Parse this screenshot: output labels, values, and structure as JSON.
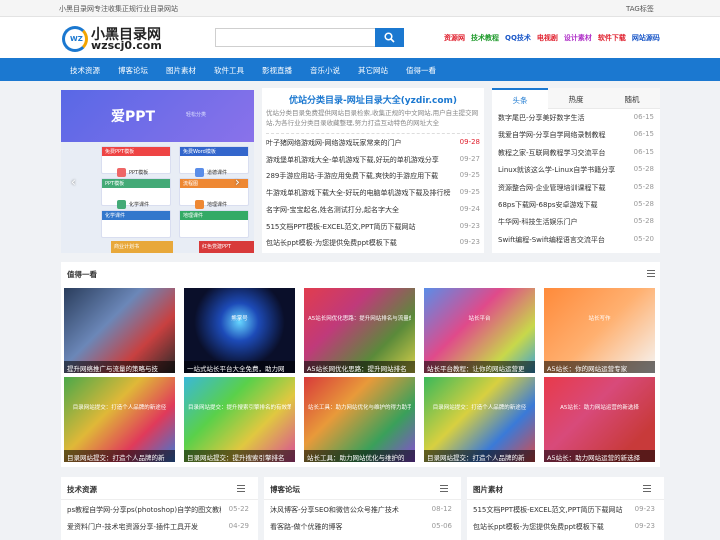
{
  "topbar": {
    "tagline": "小黑目录网专注收集正规行业目录网站",
    "tag_link": "TAG标签"
  },
  "logo": {
    "badge": "WZ",
    "cn": "小黑目录网",
    "en": "wzscj0.com"
  },
  "search": {
    "placeholder": ""
  },
  "hotlinks": [
    {
      "label": "资源网",
      "color": "#e0202e"
    },
    {
      "label": "技术教程",
      "color": "#1e9a2b"
    },
    {
      "label": "QQ技术",
      "color": "#1b58c8"
    },
    {
      "label": "电视剧",
      "color": "#e0202e"
    },
    {
      "label": "设计素材",
      "color": "#b030c8"
    },
    {
      "label": "软件下载",
      "color": "#e0202e"
    },
    {
      "label": "网站源码",
      "color": "#1b58c8"
    }
  ],
  "nav": [
    "技术资源",
    "博客论坛",
    "图片素材",
    "软件工具",
    "影视直播",
    "音乐小说",
    "其它网站",
    "值得一看"
  ],
  "slider": {
    "logo": "爱PPT",
    "sub": "轻松分类",
    "cards": [
      {
        "title": "免费PPT模板",
        "color": "#e44"
      },
      {
        "title": "免费Word模板",
        "color": "#36c"
      },
      {
        "title": "PPT模板",
        "color": "#4a7"
      },
      {
        "title": "流程图",
        "color": "#e83"
      },
      {
        "title": "化学课件",
        "color": "#37c"
      },
      {
        "title": "地理课件",
        "color": "#3a6"
      }
    ],
    "items": [
      "PPT模板",
      "道德课件",
      "化学课件",
      "地理课件"
    ],
    "banner_left": "商业计划书",
    "banner_right": "红色党建PPT",
    "prev": "‹",
    "next": "›"
  },
  "feature": {
    "title": "优站分类目录-网址目录大全(yzdir.com)",
    "desc": "优站分类目录免费提供网站目录检索,收集正规的中文网站,用户自主提交网站,为各行业分类目录收藏整理,努力打造互动特色的网址大全",
    "items": [
      {
        "title": "叶子猪网络游戏网-网络游戏玩家常来的门户",
        "date": "09-28",
        "hot": true
      },
      {
        "title": "游戏堡单机游戏大全-单机游戏下载,好玩的单机游戏分享",
        "date": "09-27",
        "hot": false
      },
      {
        "title": "289手游应用站-手游应用免费下载,爽快的手游应用下载",
        "date": "09-25",
        "hot": false
      },
      {
        "title": "牛游戏单机游戏下载大全-好玩的电脑单机游戏下载及排行榜",
        "date": "09-25",
        "hot": false
      },
      {
        "title": "名字网-宝宝起名,姓名测试打分,起名字大全",
        "date": "09-24",
        "hot": false
      },
      {
        "title": "515文档PPT模板-EXCEL范文,PPT简历下载网站",
        "date": "09-23",
        "hot": false
      },
      {
        "title": "包站长ppt模板-为您提供免费ppt模板下载",
        "date": "09-23",
        "hot": false
      }
    ]
  },
  "tabs": {
    "labels": [
      "头条",
      "热度",
      "随机"
    ],
    "items": [
      {
        "title": "数字尾巴-分享美好数字生活",
        "date": "06-15"
      },
      {
        "title": "我爱自学网-分享自学网络录制教程",
        "date": "06-15"
      },
      {
        "title": "教程之家-互联网教程学习交流平台",
        "date": "06-15"
      },
      {
        "title": "Linux就该这么学-Linux自学书籍分享",
        "date": "05-28"
      },
      {
        "title": "资源整合网-企业管理培训课程下载",
        "date": "05-28"
      },
      {
        "title": "68ps下载网-68ps安卓游戏下载",
        "date": "05-28"
      },
      {
        "title": "牛华网-科技生活娱乐门户",
        "date": "05-28"
      },
      {
        "title": "Swift编程-Swift编程语言交流平台",
        "date": "05-20"
      }
    ]
  },
  "worth": {
    "title": "值得一看",
    "thumbs": [
      {
        "caption": "提升网络推广与流量的策略与技",
        "inner": "",
        "bg": "linear-gradient(135deg,#2a3d5c,#6b87b8 40%,#c84040 70%,#2a2a2a)"
      },
      {
        "caption": "一站式站长平台大全免费，助力网",
        "inner": "熊掌号",
        "bg": "radial-gradient(circle at 50% 40%,#66d6ff 0,#1d4bb8 25%,#0a0f2a 60%)"
      },
      {
        "caption": "A5站长网优化思路：提升网站排名",
        "inner": "A5站长网优化思路：提升网站排名与流量的策略",
        "bg": "linear-gradient(135deg,#e13c4e,#c03a7a 35%,#5a8a3a 70%,#d8d04a)"
      },
      {
        "caption": "站长平台教程：让你的网站运营更",
        "inner": "站长平台",
        "bg": "linear-gradient(135deg,#5a8de8,#e04a8a 40%,#c8d84a 75%,#3aa0d8)"
      },
      {
        "caption": "A5站长：你的网站运营专家",
        "inner": "站长写作",
        "bg": "linear-gradient(135deg,#ff8a3a,#ffb070 50%,#f5f5f5)"
      },
      {
        "caption": "目录网站提交：打造个人品牌的新",
        "inner": "目录网站提交：打造个人品牌的新途径",
        "bg": "linear-gradient(135deg,#4aa84a,#e0b838 40%,#e03a5a 70%,#3a7ad8)"
      },
      {
        "caption": "目录网站提交：提升搜索引擎排名",
        "inner": "目录网站提交：提升搜索引擎排名的有效策略",
        "bg": "linear-gradient(135deg,#3ab8d8,#5ad04a 35%,#e0c840 65%,#d84a9a)"
      },
      {
        "caption": "站长工具：助力网站优化与维护的",
        "inner": "站长工具：助力网站优化与维护的得力助手",
        "bg": "linear-gradient(135deg,#d83a3a,#e89a3a 35%,#3aa05a 70%,#8a4ad8)"
      },
      {
        "caption": "目录网站提交：打造个人品牌的新",
        "inner": "目录网站提交：打造个人品牌的新途径",
        "bg": "linear-gradient(135deg,#3ab85a,#d8d040 40%,#3a7ad8 70%,#d84a4a)"
      },
      {
        "caption": "A5站长：助力网站运营的新选择",
        "inner": "A5站长：助力网站运营的新选择",
        "bg": "linear-gradient(135deg,#e83a4a,#d84a7a 40%,#c83a3a 80%)"
      }
    ]
  },
  "bottom": [
    {
      "title": "技术资源",
      "items": [
        {
          "title": "ps教程自学网-分享ps(photoshop)自学的图文教程",
          "date": "05-22"
        },
        {
          "title": "爱资料门户-技术宅资源分享-插件工具开发",
          "date": "04-29"
        }
      ]
    },
    {
      "title": "博客论坛",
      "items": [
        {
          "title": "沐风博客-分享SEO和微信公众号推广技术",
          "date": "08-12"
        },
        {
          "title": "看客路-做个优雅的博客",
          "date": "05-06"
        }
      ]
    },
    {
      "title": "图片素材",
      "items": [
        {
          "title": "515文档PPT模板-EXCEL范文,PPT简历下载网站",
          "date": "09-23"
        },
        {
          "title": "包站长ppt模板-为您提供免费ppt模板下载",
          "date": "09-23"
        }
      ]
    }
  ]
}
